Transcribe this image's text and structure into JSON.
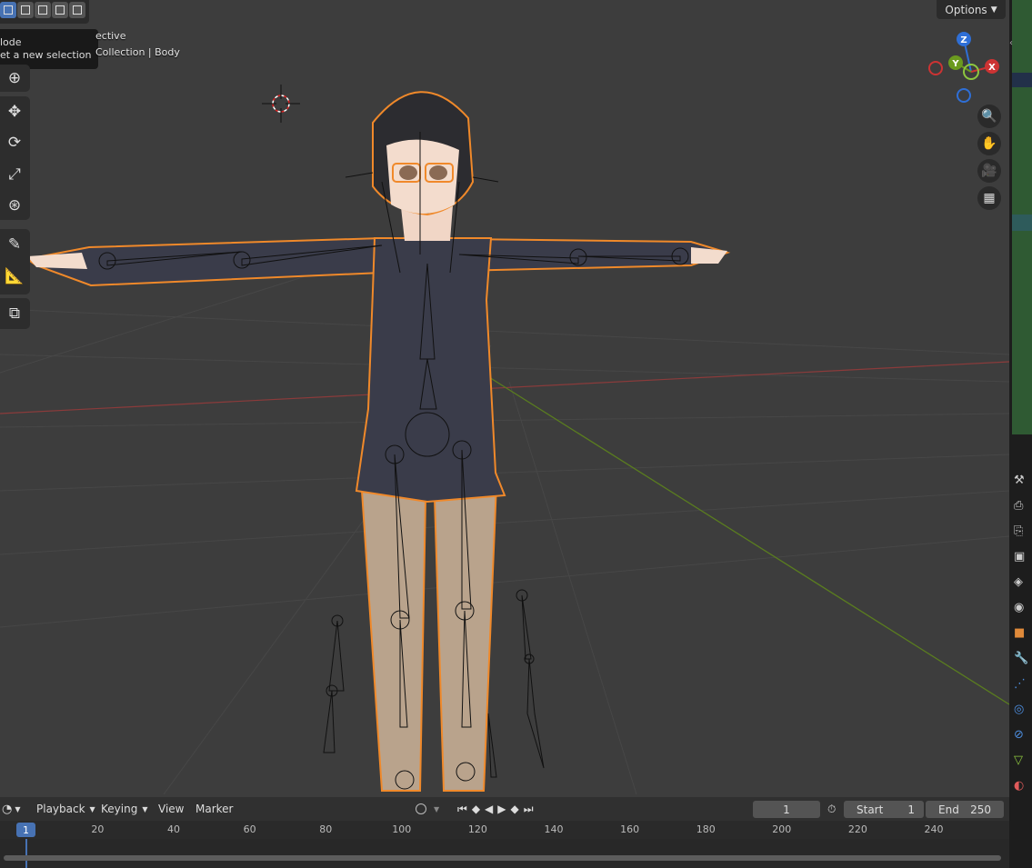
{
  "viewport": {
    "header": {
      "options_label": "Options",
      "options_chevron_icon": "chevron-down-icon"
    },
    "selection_modes": [
      "select-new-icon",
      "select-extend-icon",
      "select-subtract-icon",
      "select-difference-icon",
      "select-intersect-icon"
    ],
    "tooltip": {
      "title": "lode",
      "description": "et a new selection"
    },
    "overlay": {
      "view_name": "ective",
      "collection": "Collection | Body"
    },
    "tools": [
      "cursor-icon",
      "move-icon",
      "rotate-icon",
      "scale-icon",
      "transform-icon",
      "annotate-icon",
      "measure-icon",
      "add-cube-icon"
    ],
    "gizmo": {
      "z": "Z",
      "y": "Y",
      "x": "X"
    },
    "nav_buttons": [
      "zoom-icon",
      "pan-hand-icon",
      "camera-view-icon",
      "grid-perspective-icon"
    ]
  },
  "timeline": {
    "editor_icon": "clock-icon",
    "menus": [
      "Playback",
      "Keying",
      "View",
      "Marker"
    ],
    "current_frame": "1",
    "start_label": "Start",
    "start_value": "1",
    "end_label": "End",
    "end_value": "250",
    "ruler_ticks": [
      "20",
      "40",
      "60",
      "80",
      "100",
      "120",
      "140",
      "160",
      "180",
      "200",
      "220",
      "240"
    ],
    "playhead_frame": "1"
  },
  "colors": {
    "viewport_bg": "#3d3d3d",
    "selection_outline": "#f0892a",
    "x_axis": "#a33a3a",
    "y_axis": "#6b8e23",
    "accent": "#4772b3"
  }
}
